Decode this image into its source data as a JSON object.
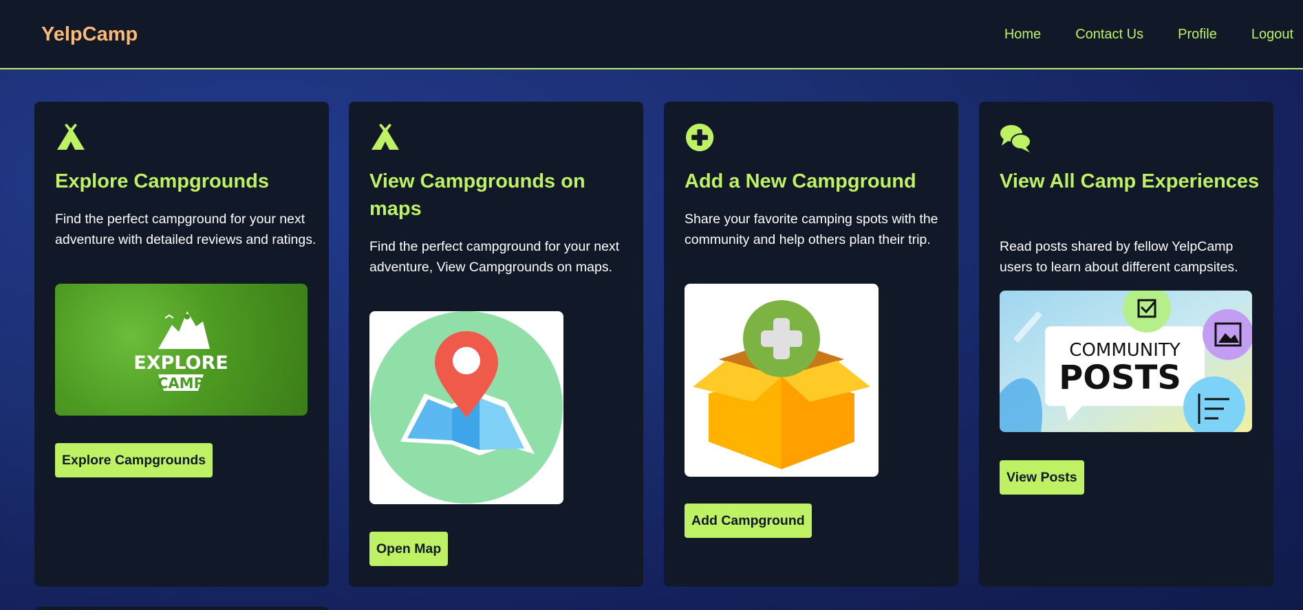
{
  "brand": "YelpCamp",
  "nav": {
    "home": "Home",
    "contact": "Contact Us",
    "profile": "Profile",
    "logout": "Logout"
  },
  "cards": [
    {
      "icon": "tent-icon",
      "title": "Explore Campgrounds",
      "text": "Find the perfect campground for your next adventure with detailed reviews and ratings.",
      "image": "explore-camp-logo",
      "image_text_top": "EXPLORE",
      "image_text_bottom": "CAMP",
      "button": "Explore Campgrounds"
    },
    {
      "icon": "tent-icon",
      "title": "View Campgrounds on maps",
      "text": "Find the perfect campground for your next adventure, View Campgrounds on maps.",
      "image": "map-pin-illustration",
      "button": "Open Map"
    },
    {
      "icon": "plus-circle-icon",
      "title": "Add a New Campground",
      "text": "Share your favorite camping spots with the community and help others plan their trip.",
      "image": "box-plus-illustration",
      "button": "Add Campground"
    },
    {
      "icon": "comments-icon",
      "title": "View All Camp Experiences",
      "text": "Read posts shared by fellow YelpCamp users to learn about different campsites.",
      "image": "community-posts-banner",
      "image_text_top": "COMMUNITY",
      "image_text_bottom": "POSTS",
      "button": "View Posts"
    }
  ],
  "colors": {
    "accent": "#bef264",
    "brand": "#fdba74",
    "card_bg": "#111827",
    "page_bg": "#1b2f72"
  }
}
